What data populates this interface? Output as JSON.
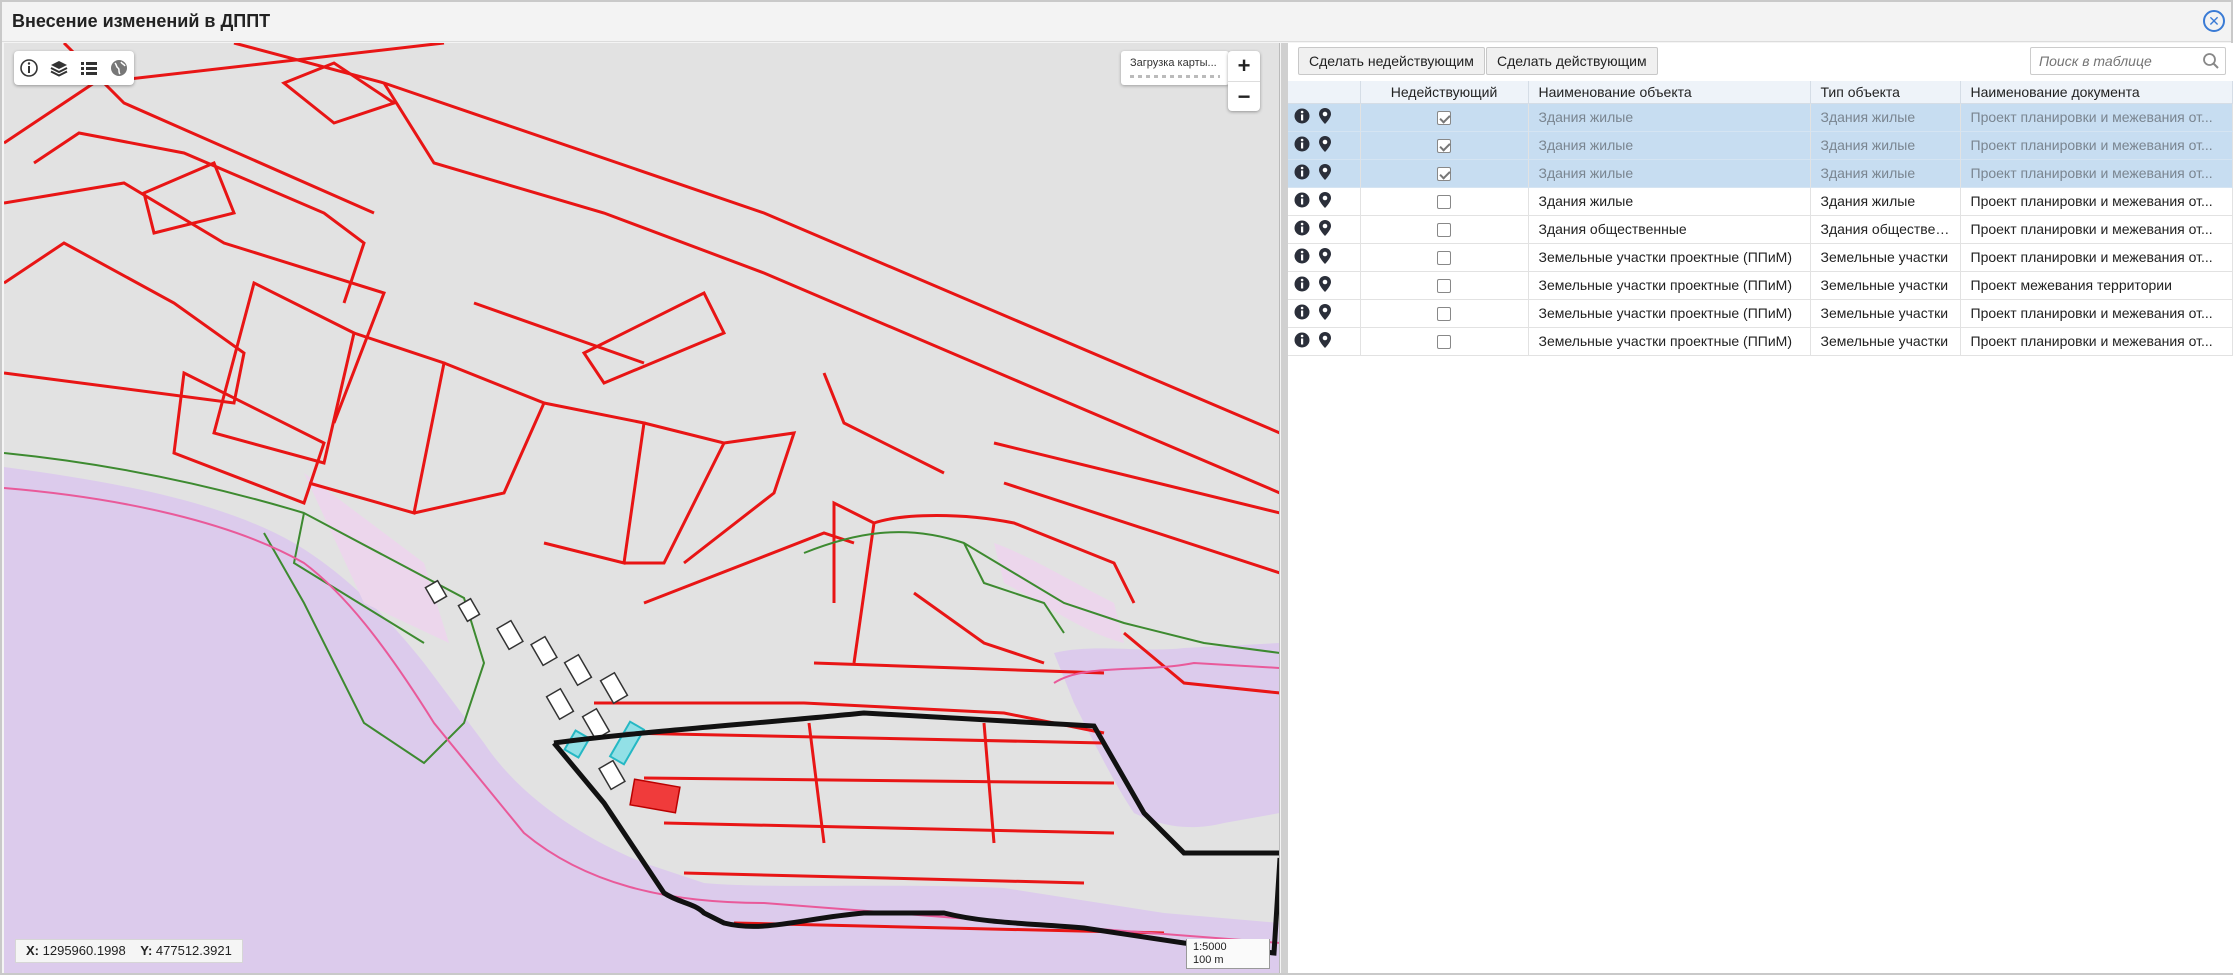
{
  "window": {
    "title": "Внесение изменений в ДППТ",
    "close_icon": "close-circle-icon"
  },
  "map": {
    "toolbar": [
      {
        "name": "info-tool",
        "icon": "info-icon"
      },
      {
        "name": "layers-tool",
        "icon": "layers-icon"
      },
      {
        "name": "list-tool",
        "icon": "list-icon"
      },
      {
        "name": "basemap-tool",
        "icon": "globe-icon"
      }
    ],
    "loading_text": "Загрузка карты...",
    "zoom_in": "+",
    "zoom_out": "−",
    "coords": {
      "x_label": "X:",
      "x_value": "1295960.1998",
      "y_label": "Y:",
      "y_value": "477512.3921"
    },
    "scale": {
      "ratio": "1:5000",
      "distance": "100 m"
    },
    "colors": {
      "background": "#e2e2e2",
      "water": "#dccbec",
      "boundary": "#e81515",
      "green": "#3d8a30",
      "route": "#111111",
      "highlight": "#5ee0ea",
      "selected": "#f03b3b"
    }
  },
  "panel": {
    "btn_inactive": "Сделать недействующим",
    "btn_active": "Сделать действующим",
    "search_placeholder": "Поиск в таблице",
    "columns": [
      "",
      "Недействующий",
      "Наименование объекта",
      "Тип объекта",
      "Наименование документа"
    ],
    "rows": [
      {
        "selected": true,
        "inactive": true,
        "name": "Здания жилые",
        "type": "Здания жилые",
        "doc": "Проект планировки и межевания от..."
      },
      {
        "selected": true,
        "inactive": true,
        "name": "Здания жилые",
        "type": "Здания жилые",
        "doc": "Проект планировки и межевания от..."
      },
      {
        "selected": true,
        "inactive": true,
        "name": "Здания жилые",
        "type": "Здания жилые",
        "doc": "Проект планировки и межевания от..."
      },
      {
        "selected": false,
        "inactive": false,
        "name": "Здания жилые",
        "type": "Здания жилые",
        "doc": "Проект планировки и межевания от..."
      },
      {
        "selected": false,
        "inactive": false,
        "name": "Здания общественные",
        "type": "Здания общественн",
        "doc": "Проект планировки и межевания от..."
      },
      {
        "selected": false,
        "inactive": false,
        "name": "Земельные участки проектные (ППиМ)",
        "type": "Земельные участки",
        "doc": "Проект планировки и межевания от..."
      },
      {
        "selected": false,
        "inactive": false,
        "name": "Земельные участки проектные (ППиМ)",
        "type": "Земельные участки",
        "doc": "Проект межевания территории"
      },
      {
        "selected": false,
        "inactive": false,
        "name": "Земельные участки проектные (ППиМ)",
        "type": "Земельные участки",
        "doc": "Проект планировки и межевания от..."
      },
      {
        "selected": false,
        "inactive": false,
        "name": "Земельные участки проектные (ППиМ)",
        "type": "Земельные участки",
        "doc": "Проект планировки и межевания от..."
      }
    ]
  }
}
